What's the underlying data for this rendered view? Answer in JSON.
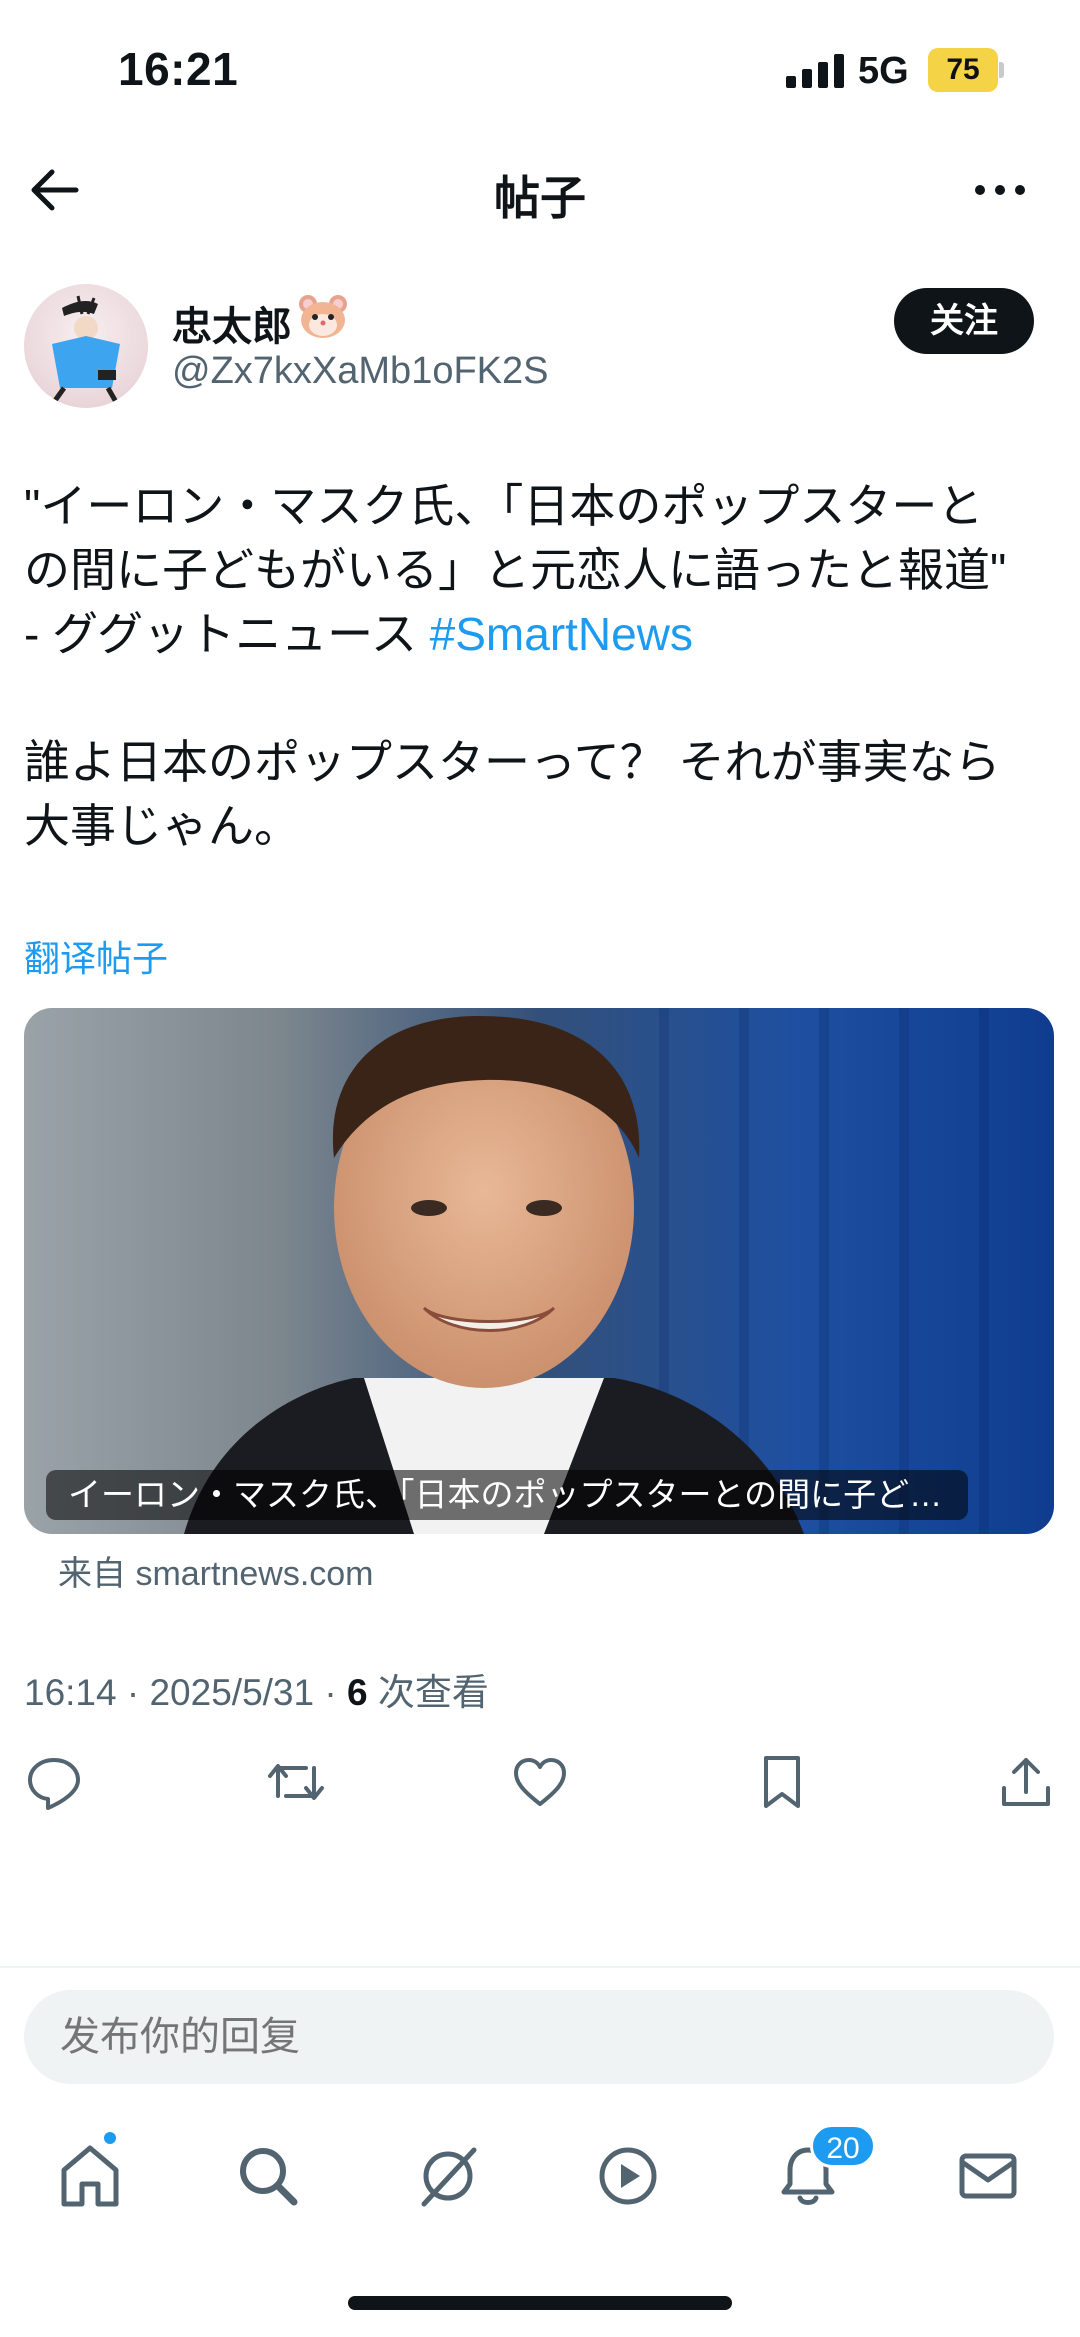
{
  "status_bar": {
    "time": "16:21",
    "network": "5G",
    "battery": "75"
  },
  "nav": {
    "title": "帖子"
  },
  "author": {
    "name": "忠太郎",
    "handle": "@Zx7kxXaMb1oFK2S"
  },
  "follow_label": "关注",
  "post": {
    "line1": "\"イーロン・マスク氏、「日本のポップスターと",
    "line2": "の間に子どもがいる」と元恋人に語ったと報道\"",
    "line3_prefix": "- ググットニュース ",
    "hashtag": "#SmartNews",
    "line4": "誰よ日本のポップスターって？ それが事実なら",
    "line5": "大事じゃん。"
  },
  "translate_label": "翻译帖子",
  "card": {
    "caption": "イーロン・マスク氏、「日本のポップスターとの間に子ど…",
    "source": "来自 smartnews.com"
  },
  "meta": {
    "time": "16:14",
    "date": "2025/5/31",
    "views_count": "6",
    "views_label": "次查看"
  },
  "actions": [
    "reply-icon",
    "repost-icon",
    "like-icon",
    "bookmark-icon",
    "share-icon"
  ],
  "reply": {
    "placeholder": "发布你的回复"
  },
  "tabbar": {
    "notifications_badge": "20"
  },
  "colors": {
    "accent": "#1d9bf0",
    "text": "#0f1419",
    "muted": "#536471",
    "battery": "#f5d347"
  }
}
